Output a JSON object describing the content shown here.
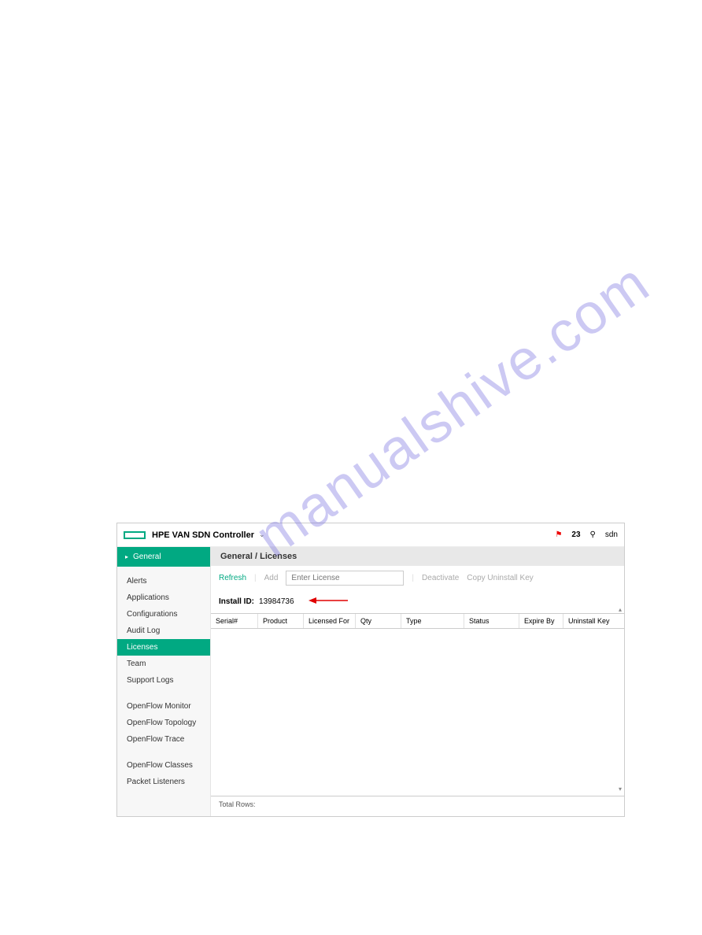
{
  "watermark": "manualshive.com",
  "header": {
    "title": "HPE VAN SDN Controller",
    "notification_count": "23",
    "user": "sdn"
  },
  "sidebar": {
    "section_label": "General",
    "groups": [
      {
        "items": [
          {
            "label": "Alerts",
            "active": false
          },
          {
            "label": "Applications",
            "active": false
          },
          {
            "label": "Configurations",
            "active": false
          },
          {
            "label": "Audit Log",
            "active": false
          },
          {
            "label": "Licenses",
            "active": true
          },
          {
            "label": "Team",
            "active": false
          },
          {
            "label": "Support Logs",
            "active": false
          }
        ]
      },
      {
        "items": [
          {
            "label": "OpenFlow Monitor",
            "active": false
          },
          {
            "label": "OpenFlow Topology",
            "active": false
          },
          {
            "label": "OpenFlow Trace",
            "active": false
          }
        ]
      },
      {
        "items": [
          {
            "label": "OpenFlow Classes",
            "active": false
          },
          {
            "label": "Packet Listeners",
            "active": false
          }
        ]
      }
    ]
  },
  "content": {
    "breadcrumb": "General / Licenses",
    "toolbar": {
      "refresh_label": "Refresh",
      "add_label": "Add",
      "license_placeholder": "Enter License",
      "deactivate_label": "Deactivate",
      "copy_label": "Copy Uninstall Key"
    },
    "install_id": {
      "label": "Install ID:",
      "value": "13984736"
    },
    "table": {
      "headers": {
        "serial": "Serial#",
        "product": "Product",
        "licensed_for": "Licensed For",
        "qty": "Qty",
        "type": "Type",
        "status": "Status",
        "expire_by": "Expire By",
        "uninstall_key": "Uninstall Key"
      }
    },
    "footer": {
      "total_rows_label": "Total Rows:"
    }
  }
}
